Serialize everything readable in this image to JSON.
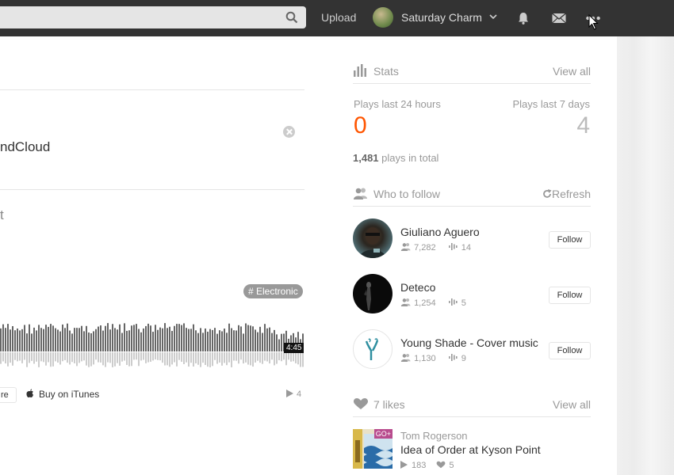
{
  "header": {
    "upload_label": "Upload",
    "username": "Saturday Charm"
  },
  "track": {
    "title_fragment": "ndCloud",
    "partial_char": "t",
    "tag": "# Electronic",
    "duration": "4:45",
    "share_fragment": "re",
    "itunes_label": "Buy on iTunes",
    "play_count": "4"
  },
  "stats": {
    "heading": "Stats",
    "view_all": "View all",
    "last24_label": "Plays last 24 hours",
    "last24_value": "0",
    "last7_label": "Plays last 7 days",
    "last7_value": "4",
    "total_number": "1,481",
    "total_suffix": "plays in total"
  },
  "who_to_follow": {
    "heading": "Who to follow",
    "refresh": "Refresh",
    "follow_label": "Follow",
    "items": [
      {
        "name": "Giuliano Aguero",
        "followers": "7,282",
        "tracks": "14"
      },
      {
        "name": "Deteco",
        "followers": "1,254",
        "tracks": "5"
      },
      {
        "name": "Young Shade - Cover music",
        "followers": "1,130",
        "tracks": "9"
      }
    ]
  },
  "likes": {
    "heading": "7 likes",
    "view_all": "View all",
    "item": {
      "user": "Tom Rogerson",
      "title": "Idea of Order at Kyson Point",
      "badge": "GO+",
      "plays": "183",
      "likes": "5"
    }
  },
  "colors": {
    "accent": "#f50",
    "header_bg": "#333333"
  }
}
